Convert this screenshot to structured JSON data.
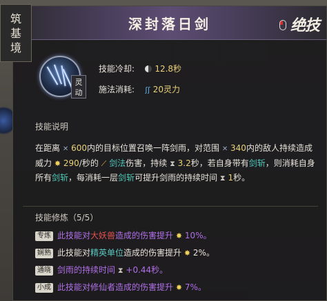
{
  "realm": {
    "chars": [
      "筑",
      "基",
      "境"
    ]
  },
  "tooltip": {
    "title": "深封落日剑",
    "ult_label": "绝技",
    "tag_chars": [
      "灵",
      "动"
    ],
    "cooldown_label": "技能冷却:",
    "cooldown_value": "12.8秒",
    "cost_label": "施法消耗:",
    "cost_value": "20灵力",
    "desc_header": "技能说明",
    "desc": {
      "t1": "在距离",
      "range1": "600",
      "t2": "内的目标位置召唤一阵剑雨，对范围",
      "range2": "340",
      "t3": "内的敌人持续造成威力",
      "power": "290",
      "t4": "/秒的",
      "key1": "剑法",
      "t5": "伤害，持续",
      "dur": "3.2",
      "t6": "秒，若自身带有",
      "key2": "剑斩",
      "t7": "，则消耗自身所有",
      "key3": "剑斩",
      "t8": "，每消耗一层",
      "key4": "剑斩",
      "t9": "可提升剑雨的持续时间",
      "dur2": "1",
      "t10": "秒。"
    },
    "mods_header": "技能修炼（5/5）",
    "mods": [
      {
        "badge": "专炼",
        "text1": "此技能对",
        "hi": "大妖兽",
        "text2": "造成的伤害提升",
        "val": "10%。"
      },
      {
        "badge": "娴熟",
        "text1": "此技能对",
        "hi": "精英单位",
        "text2": "造成的伤害提升",
        "val": "2%。"
      },
      {
        "badge": "通晓",
        "text1": "剑雨的持续时间",
        "val": "+0.44秒。"
      },
      {
        "badge": "小成",
        "text1": "此技能对修仙者造成的伤害提升",
        "val": "7%。"
      }
    ]
  },
  "colors": {
    "accent_gold": "#ead27a",
    "key_teal": "#4fc7b8",
    "mod_purple": "#b070e8",
    "mod_red": "#e05050"
  },
  "icons": {
    "skill": "sword-rain-icon",
    "cooldown": "moon-icon",
    "cost": "mana-icon",
    "ult": "mouse-icon"
  }
}
